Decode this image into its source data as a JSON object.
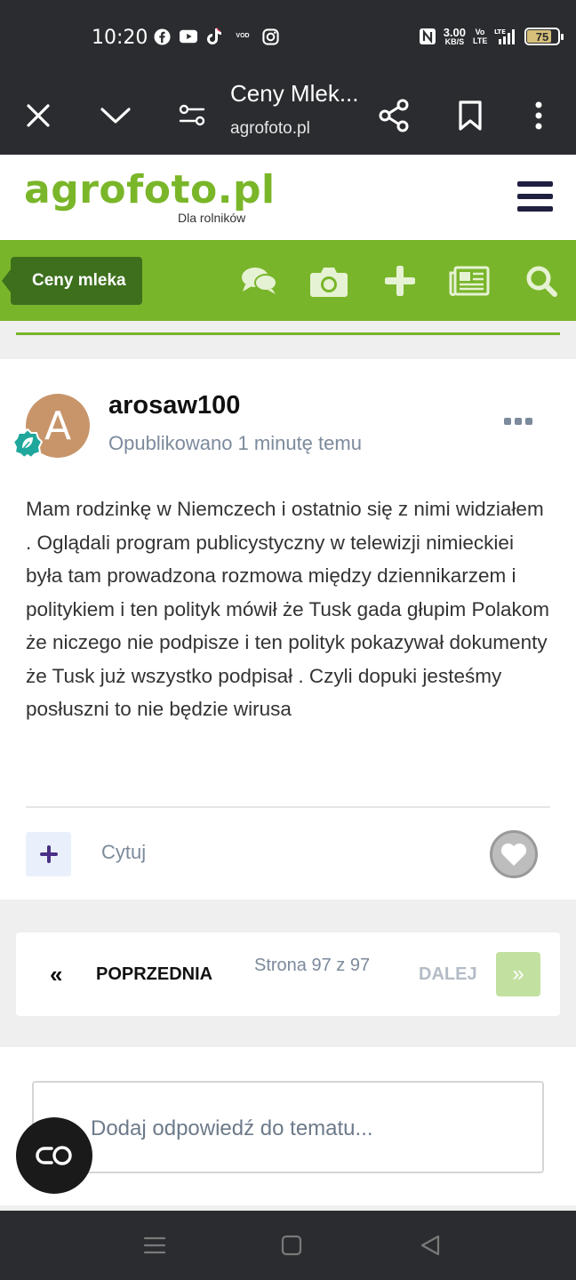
{
  "status_bar": {
    "time": "10:20",
    "apps": [
      "facebook-icon",
      "youtube-icon",
      "tiktok-icon",
      "vod-icon",
      "instagram-icon"
    ],
    "vod_label": "VOD",
    "nfc_icon": "nfc-icon",
    "speed_value": "3.00",
    "speed_unit": "KB/S",
    "network": "Vo LTE",
    "battery": "75"
  },
  "browser": {
    "title": "Ceny Mlek...",
    "url": "agrofoto.pl"
  },
  "site": {
    "logo": "agrofoto.pl",
    "tagline": "Dla rolników",
    "brand_color": "#79b52a"
  },
  "nav": {
    "breadcrumb": "Ceny mleka",
    "icons": [
      "chat-icon",
      "camera-icon",
      "plus-icon",
      "newspaper-icon",
      "search-icon"
    ]
  },
  "post": {
    "avatar_letter": "A",
    "username": "arosaw100",
    "published": "Opublikowano 1 minutę temu",
    "body": "Mam rodzinkę w Niemczech i ostatnio się z nimi widziałem . Oglądali program  publicystyczny w telewizji nimieckiei była tam prowadzona  rozmowa między dziennikarzem i politykiem i ten polityk mówił że Tusk gada głupim Polakom że niczego nie podpisze i ten polityk pokazywał dokumenty że Tusk już wszystko podpisał . Czyli dopuki jesteśmy posłuszni to nie będzie wirusa",
    "quote_label": "Cytuj"
  },
  "pagination": {
    "prev_label": "POPRZEDNIA",
    "page_info": "Strona 97 z 97",
    "next_label": "DALEJ"
  },
  "reply": {
    "placeholder": "Dodaj odpowiedź do tematu..."
  }
}
